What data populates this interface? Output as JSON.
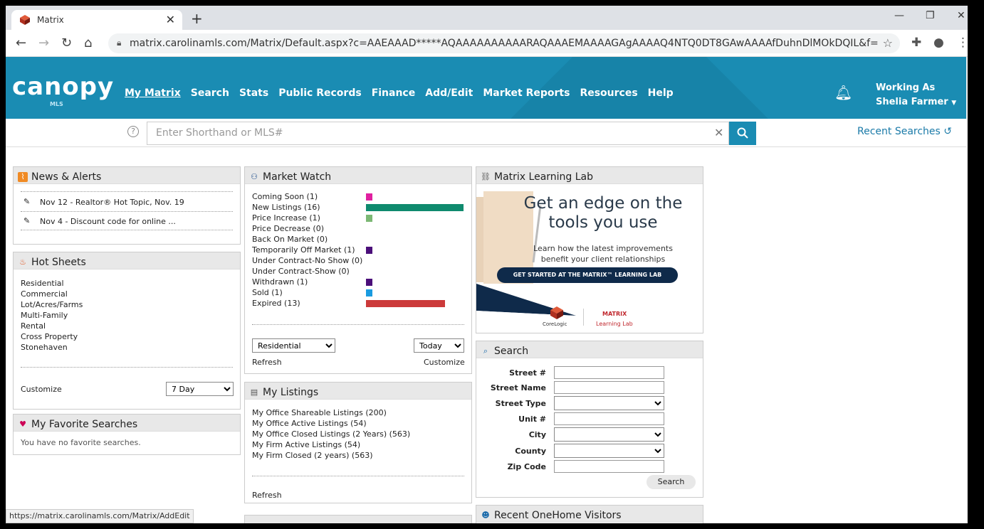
{
  "browser": {
    "tab_title": "Matrix",
    "url": "matrix.carolinamls.com/Matrix/Default.aspx?c=AAEAAAD*****AQAAAAAAAAAARAQAAAEMAAAAGAgAAAAQ4NTQ0DT8GAwAAAAfDuhnDlMOkDQIL&f=",
    "status_url": "https://matrix.carolinamls.com/Matrix/AddEdit"
  },
  "header": {
    "logo": "canopy",
    "logo_sub": "MLS",
    "nav": [
      "My Matrix",
      "Search",
      "Stats",
      "Public Records",
      "Finance",
      "Add/Edit",
      "Market Reports",
      "Resources",
      "Help"
    ],
    "working_as_label": "Working As",
    "user_name": "Shelia Farmer"
  },
  "shorthand": {
    "placeholder": "Enter Shorthand or MLS#",
    "recent_searches": "Recent Searches"
  },
  "news": {
    "title": "News & Alerts",
    "items": [
      "Nov 12 - Realtor® Hot Topic, Nov. 19",
      "Nov 4 - Discount code for online ..."
    ]
  },
  "hot_sheets": {
    "title": "Hot Sheets",
    "items": [
      "Residential",
      "Commercial",
      "Lot/Acres/Farms",
      "Multi-Family",
      "Rental",
      "Cross Property",
      "Stonehaven"
    ],
    "customize": "Customize",
    "period": "7 Day"
  },
  "favorites": {
    "title": "My Favorite Searches",
    "empty": "You have no favorite searches."
  },
  "market_watch": {
    "title": "Market Watch",
    "rows": [
      {
        "label": "Coming Soon (1)",
        "value": 1,
        "color": "#e020a0"
      },
      {
        "label": "New Listings (16)",
        "value": 16,
        "color": "#0f8a6e"
      },
      {
        "label": "Price Increase (1)",
        "value": 1,
        "color": "#7cb874"
      },
      {
        "label": "Price Decrease (0)",
        "value": 0,
        "color": "#888888"
      },
      {
        "label": "Back On Market (0)",
        "value": 0,
        "color": "#888888"
      },
      {
        "label": "Temporarily Off Market (1)",
        "value": 1,
        "color": "#4b0f7a"
      },
      {
        "label": "Under Contract-No Show (0)",
        "value": 0,
        "color": "#888888"
      },
      {
        "label": "Under Contract-Show (0)",
        "value": 0,
        "color": "#888888"
      },
      {
        "label": "Withdrawn (1)",
        "value": 1,
        "color": "#4b0f7a"
      },
      {
        "label": "Sold (1)",
        "value": 1,
        "color": "#1a9be0"
      },
      {
        "label": "Expired (13)",
        "value": 13,
        "color": "#cc3a3a"
      }
    ],
    "property_type": "Residential",
    "period": "Today",
    "refresh": "Refresh",
    "customize": "Customize"
  },
  "my_listings": {
    "title": "My Listings",
    "items": [
      "My Office Shareable Listings (200)",
      "My Office Active Listings (54)",
      "My Office Closed Listings (2 Years) (563)",
      "My Firm Active Listings (54)",
      "My Firm Closed (2 years) (563)"
    ],
    "refresh": "Refresh"
  },
  "learning_lab": {
    "title": "Matrix Learning Lab",
    "headline1": "Get an edge on the",
    "headline2": "tools you use",
    "sub1": "Learn how the latest improvements",
    "sub2": "benefit your client relationships",
    "cta": "GET STARTED AT THE MATRIX™ LEARNING LAB",
    "brand1": "CoreLogic",
    "brand2_top": "MATRIX",
    "brand2_bottom": "Learning Lab"
  },
  "search_panel": {
    "title": "Search",
    "labels": [
      "Street #",
      "Street Name",
      "Street Type",
      "Unit #",
      "City",
      "County",
      "Zip Code"
    ],
    "button": "Search"
  },
  "visitors": {
    "title": "Recent OneHome Visitors"
  }
}
